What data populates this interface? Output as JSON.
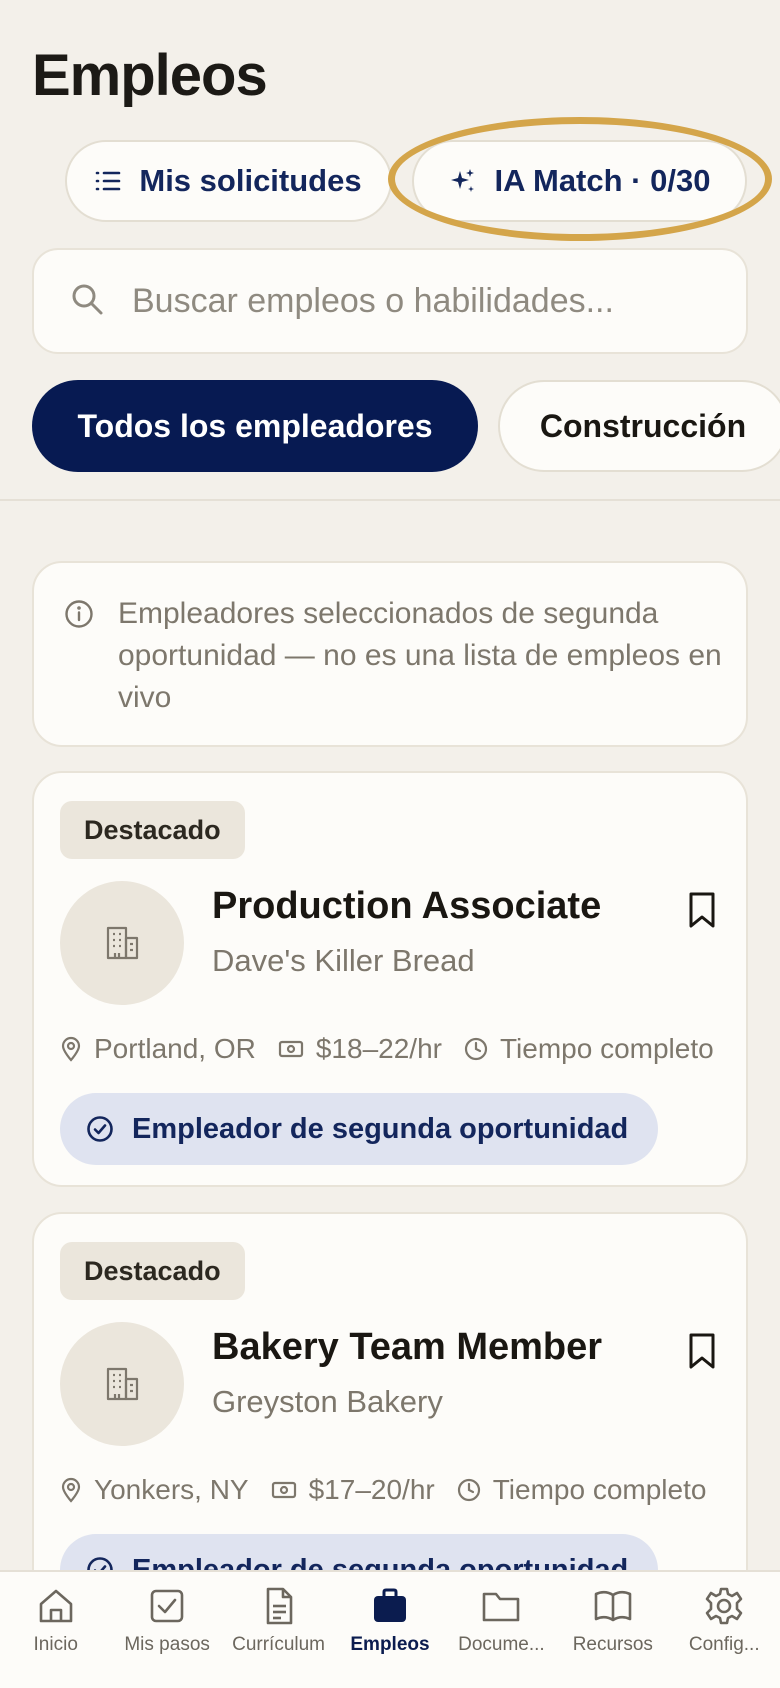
{
  "header": {
    "title": "Empleos"
  },
  "actions": {
    "applications_label": "Mis solicitudes",
    "ai_match_label": "IA Match · 0/30"
  },
  "search": {
    "placeholder": "Buscar empleos o habilidades..."
  },
  "filters": [
    {
      "label": "Todos los empleadores",
      "active": true
    },
    {
      "label": "Construcción",
      "active": false
    }
  ],
  "notice": {
    "text": "Empleadores seleccionados de segunda oportunidad — no es una lista de empleos en vivo"
  },
  "jobs": [
    {
      "badge": "Destacado",
      "title": "Production Associate",
      "company": "Dave's Killer Bread",
      "location": "Portland, OR",
      "pay": "$18–22/hr",
      "schedule": "Tiempo completo",
      "employer_tag": "Empleador de segunda oportunidad"
    },
    {
      "badge": "Destacado",
      "title": "Bakery Team Member",
      "company": "Greyston Bakery",
      "location": "Yonkers, NY",
      "pay": "$17–20/hr",
      "schedule": "Tiempo completo",
      "employer_tag": "Empleador de segunda oportunidad"
    }
  ],
  "nav": [
    {
      "label": "Inicio",
      "icon": "home-icon"
    },
    {
      "label": "Mis pasos",
      "icon": "checkbox-icon"
    },
    {
      "label": "Currículum",
      "icon": "document-icon"
    },
    {
      "label": "Empleos",
      "icon": "briefcase-icon",
      "active": true
    },
    {
      "label": "Docume...",
      "icon": "folder-icon"
    },
    {
      "label": "Recursos",
      "icon": "book-icon"
    },
    {
      "label": "Config...",
      "icon": "gear-icon"
    }
  ],
  "colors": {
    "primary": "#071a52",
    "highlight": "#d4a54a",
    "background": "#f3f0ea"
  }
}
